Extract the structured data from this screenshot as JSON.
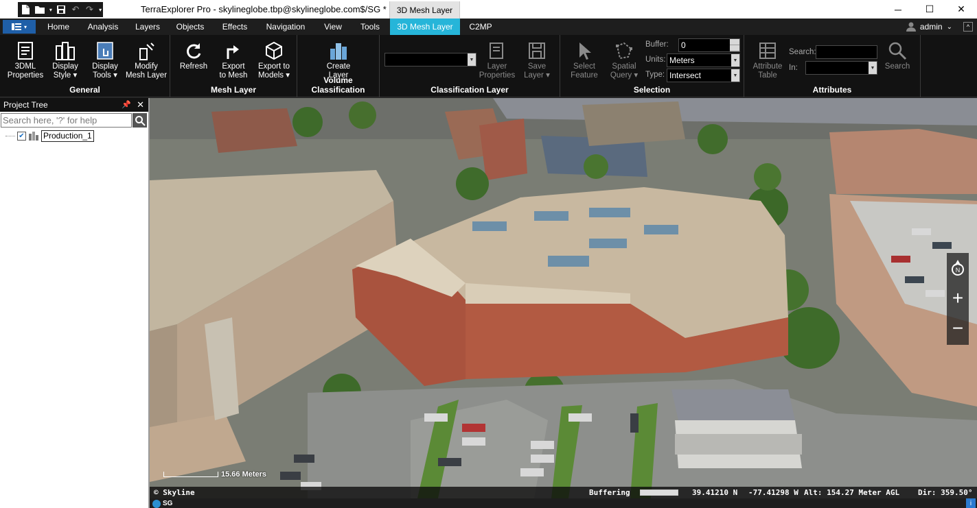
{
  "titlebar": {
    "title": "TerraExplorer Pro - skylineglobe.tbp@skylineglobe.com$/SG *",
    "context_tab": "3D Mesh Layer",
    "minimize": "─",
    "maximize": "☐",
    "close": "✕"
  },
  "tabs": [
    "Home",
    "Analysis",
    "Layers",
    "Objects",
    "Effects",
    "Navigation",
    "View",
    "Tools",
    "3D Mesh Layer",
    "C2MP"
  ],
  "active_tab": "3D Mesh Layer",
  "user": {
    "name": "admin"
  },
  "ribbon": {
    "general": {
      "label": "General",
      "buttons": [
        "3DML\nProperties",
        "Display\nStyle ▾",
        "Display\nTools ▾",
        "Modify\nMesh Layer"
      ]
    },
    "mesh_layer": {
      "label": "Mesh Layer",
      "buttons": [
        "Refresh",
        "Export\nto Mesh",
        "Export to\nModels ▾"
      ]
    },
    "volume": {
      "label": "Volume Classification",
      "buttons": [
        "Create\nLayer"
      ]
    },
    "classification": {
      "label": "Classification Layer",
      "combo_value": "",
      "buttons": [
        "Layer\nProperties",
        "Save\nLayer ▾"
      ]
    },
    "selection": {
      "label": "Selection",
      "buttons": [
        "Select\nFeature",
        "Spatial\nQuery ▾"
      ],
      "buffer_label": "Buffer:",
      "buffer_value": "0",
      "units_label": "Units:",
      "units_value": "Meters",
      "type_label": "Type:",
      "type_value": "Intersect"
    },
    "attributes": {
      "label": "Attributes",
      "buttons": [
        "Attribute\nTable",
        "Search"
      ],
      "search_label": "Search:",
      "search_value": "",
      "in_label": "In:",
      "in_value": ""
    }
  },
  "project_tree": {
    "title": "Project Tree",
    "search_placeholder": "Search here, '?' for help",
    "items": [
      {
        "label": "Production_1",
        "checked": true
      }
    ]
  },
  "view": {
    "scale_label": "15.66 Meters",
    "copyright": "© Skyline"
  },
  "status": {
    "buffering": "Buffering",
    "lat": "39.41210 N",
    "lon": "-77.41298 W",
    "alt": "Alt: 154.27 Meter AGL",
    "dir": "Dir: 359.50°"
  },
  "bottombar": {
    "badge": "SG"
  },
  "colors": {
    "accent": "#26b5d9",
    "app_menu": "#1f5fa8",
    "ribbon_bg": "#121212"
  }
}
